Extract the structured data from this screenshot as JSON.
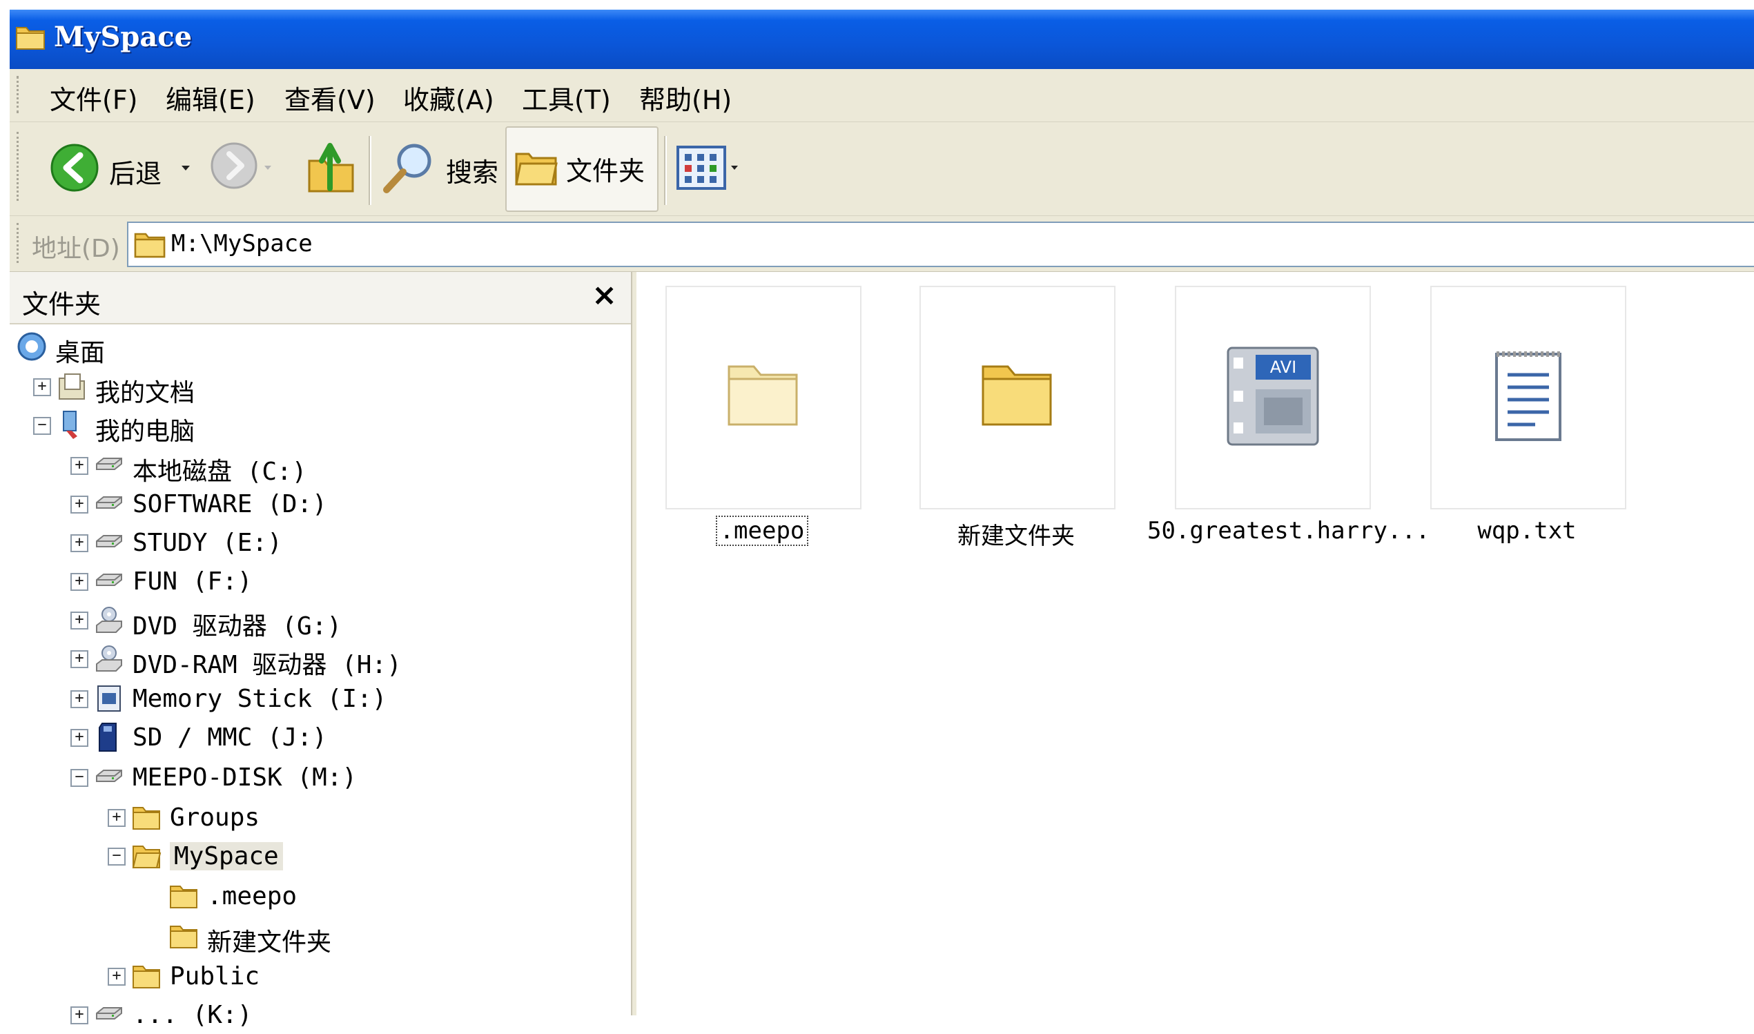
{
  "top_strip": {
    "ghost_text": "... ... ... ... ... ..."
  },
  "window": {
    "title": "MySpace"
  },
  "menu": {
    "items": [
      "文件(F)",
      "编辑(E)",
      "查看(V)",
      "收藏(A)",
      "工具(T)",
      "帮助(H)"
    ]
  },
  "toolbar": {
    "back_label": "后退",
    "search_label": "搜索",
    "folders_label": "文件夹"
  },
  "address": {
    "label": "地址(D)",
    "value": "M:\\MySpace"
  },
  "folder_pane": {
    "title": "文件夹",
    "close_label": "×",
    "tree": [
      {
        "label": "桌面",
        "icon": "desktop-icon"
      },
      {
        "label": "我的文档",
        "icon": "my-documents-icon",
        "expander": "+"
      },
      {
        "label": "我的电脑",
        "icon": "my-computer-icon",
        "expander": "-"
      },
      {
        "label": "本地磁盘 (C:)",
        "icon": "drive-icon",
        "expander": "+"
      },
      {
        "label": "SOFTWARE (D:)",
        "icon": "drive-icon",
        "expander": "+"
      },
      {
        "label": "STUDY (E:)",
        "icon": "drive-icon",
        "expander": "+"
      },
      {
        "label": "FUN (F:)",
        "icon": "drive-icon",
        "expander": "+"
      },
      {
        "label": "DVD 驱动器 (G:)",
        "icon": "dvd-drive-icon",
        "expander": "+"
      },
      {
        "label": "DVD-RAM 驱动器 (H:)",
        "icon": "dvd-drive-icon",
        "expander": "+"
      },
      {
        "label": "Memory Stick (I:)",
        "icon": "memory-stick-icon",
        "expander": "+"
      },
      {
        "label": "SD / MMC (J:)",
        "icon": "sd-card-icon",
        "expander": "+"
      },
      {
        "label": "MEEPO-DISK (M:)",
        "icon": "drive-icon",
        "expander": "-"
      },
      {
        "label": "Groups",
        "icon": "folder-icon",
        "expander": "+"
      },
      {
        "label": "MySpace",
        "icon": "folder-open-icon",
        "expander": "-"
      },
      {
        "label": ".meepo",
        "icon": "folder-icon"
      },
      {
        "label": "新建文件夹",
        "icon": "folder-icon"
      },
      {
        "label": "Public",
        "icon": "folder-icon",
        "expander": "+"
      },
      {
        "label": "... (K:)",
        "icon": "drive-icon",
        "expander": "+"
      }
    ]
  },
  "files": [
    {
      "name": ".meepo",
      "icon": "folder-light-icon",
      "selected": true
    },
    {
      "name": "新建文件夹",
      "icon": "folder-icon"
    },
    {
      "name": "50.greatest.harry...",
      "icon": "avi-video-icon"
    },
    {
      "name": "wqp.txt",
      "icon": "text-file-icon"
    }
  ],
  "colors": {
    "titlebar": "#0b56d8",
    "chrome": "#ece9d8",
    "folder_yellow": "#f3d36b"
  }
}
